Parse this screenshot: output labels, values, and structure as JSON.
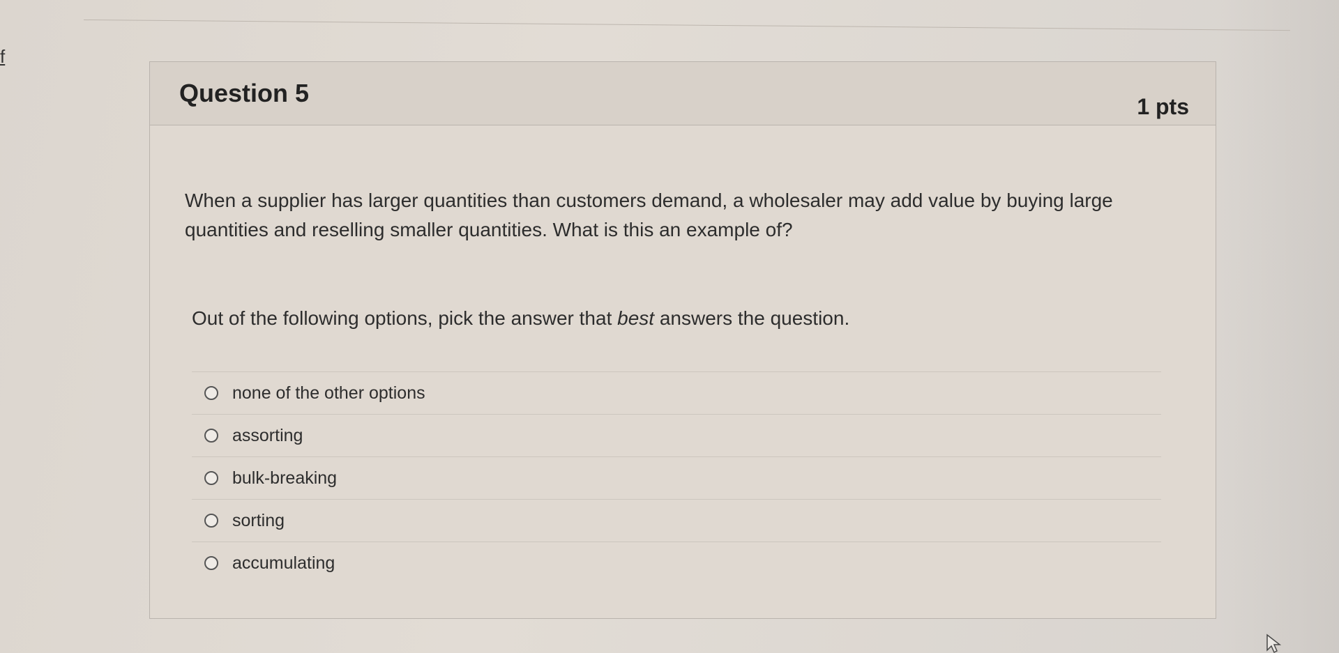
{
  "sidebar": {
    "link_fragment": "f"
  },
  "question": {
    "title": "Question 5",
    "points": "1 pts",
    "text": "When a supplier has larger quantities than customers demand, a wholesaler may add value by buying large quantities and reselling smaller quantities.  What is this an example of?",
    "instruction_prefix": "Out of the following options, pick the answer that ",
    "instruction_emphasis": "best",
    "instruction_suffix": " answers the question.",
    "answers": [
      {
        "label": "none of the other options"
      },
      {
        "label": "assorting"
      },
      {
        "label": "bulk-breaking"
      },
      {
        "label": "sorting"
      },
      {
        "label": "accumulating"
      }
    ]
  },
  "icons": {
    "cursor": "mouse-pointer-icon",
    "radio": "radio-unselected-icon"
  }
}
